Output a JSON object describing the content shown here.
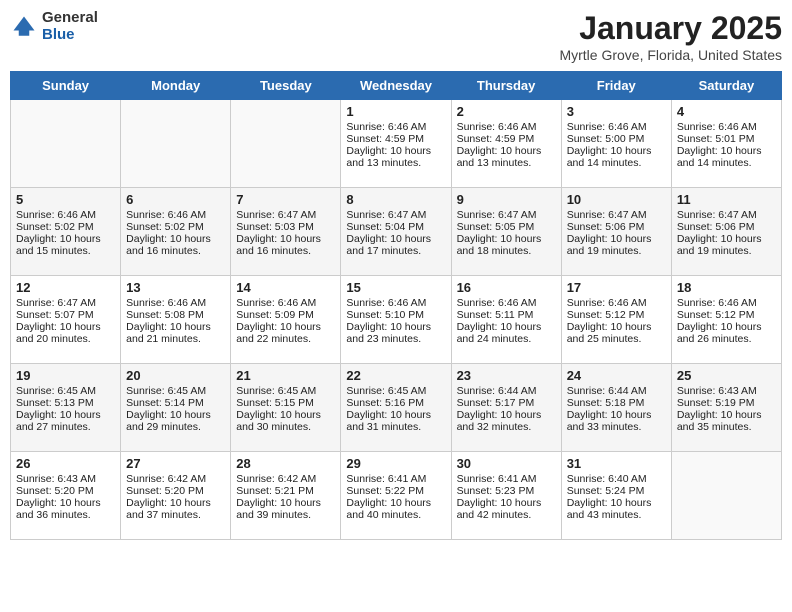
{
  "logo": {
    "general": "General",
    "blue": "Blue"
  },
  "title": "January 2025",
  "subtitle": "Myrtle Grove, Florida, United States",
  "weekdays": [
    "Sunday",
    "Monday",
    "Tuesday",
    "Wednesday",
    "Thursday",
    "Friday",
    "Saturday"
  ],
  "weeks": [
    [
      {
        "day": "",
        "content": ""
      },
      {
        "day": "",
        "content": ""
      },
      {
        "day": "",
        "content": ""
      },
      {
        "day": "1",
        "content": "Sunrise: 6:46 AM\nSunset: 4:59 PM\nDaylight: 10 hours\nand 13 minutes."
      },
      {
        "day": "2",
        "content": "Sunrise: 6:46 AM\nSunset: 4:59 PM\nDaylight: 10 hours\nand 13 minutes."
      },
      {
        "day": "3",
        "content": "Sunrise: 6:46 AM\nSunset: 5:00 PM\nDaylight: 10 hours\nand 14 minutes."
      },
      {
        "day": "4",
        "content": "Sunrise: 6:46 AM\nSunset: 5:01 PM\nDaylight: 10 hours\nand 14 minutes."
      }
    ],
    [
      {
        "day": "5",
        "content": "Sunrise: 6:46 AM\nSunset: 5:02 PM\nDaylight: 10 hours\nand 15 minutes."
      },
      {
        "day": "6",
        "content": "Sunrise: 6:46 AM\nSunset: 5:02 PM\nDaylight: 10 hours\nand 16 minutes."
      },
      {
        "day": "7",
        "content": "Sunrise: 6:47 AM\nSunset: 5:03 PM\nDaylight: 10 hours\nand 16 minutes."
      },
      {
        "day": "8",
        "content": "Sunrise: 6:47 AM\nSunset: 5:04 PM\nDaylight: 10 hours\nand 17 minutes."
      },
      {
        "day": "9",
        "content": "Sunrise: 6:47 AM\nSunset: 5:05 PM\nDaylight: 10 hours\nand 18 minutes."
      },
      {
        "day": "10",
        "content": "Sunrise: 6:47 AM\nSunset: 5:06 PM\nDaylight: 10 hours\nand 19 minutes."
      },
      {
        "day": "11",
        "content": "Sunrise: 6:47 AM\nSunset: 5:06 PM\nDaylight: 10 hours\nand 19 minutes."
      }
    ],
    [
      {
        "day": "12",
        "content": "Sunrise: 6:47 AM\nSunset: 5:07 PM\nDaylight: 10 hours\nand 20 minutes."
      },
      {
        "day": "13",
        "content": "Sunrise: 6:46 AM\nSunset: 5:08 PM\nDaylight: 10 hours\nand 21 minutes."
      },
      {
        "day": "14",
        "content": "Sunrise: 6:46 AM\nSunset: 5:09 PM\nDaylight: 10 hours\nand 22 minutes."
      },
      {
        "day": "15",
        "content": "Sunrise: 6:46 AM\nSunset: 5:10 PM\nDaylight: 10 hours\nand 23 minutes."
      },
      {
        "day": "16",
        "content": "Sunrise: 6:46 AM\nSunset: 5:11 PM\nDaylight: 10 hours\nand 24 minutes."
      },
      {
        "day": "17",
        "content": "Sunrise: 6:46 AM\nSunset: 5:12 PM\nDaylight: 10 hours\nand 25 minutes."
      },
      {
        "day": "18",
        "content": "Sunrise: 6:46 AM\nSunset: 5:12 PM\nDaylight: 10 hours\nand 26 minutes."
      }
    ],
    [
      {
        "day": "19",
        "content": "Sunrise: 6:45 AM\nSunset: 5:13 PM\nDaylight: 10 hours\nand 27 minutes."
      },
      {
        "day": "20",
        "content": "Sunrise: 6:45 AM\nSunset: 5:14 PM\nDaylight: 10 hours\nand 29 minutes."
      },
      {
        "day": "21",
        "content": "Sunrise: 6:45 AM\nSunset: 5:15 PM\nDaylight: 10 hours\nand 30 minutes."
      },
      {
        "day": "22",
        "content": "Sunrise: 6:45 AM\nSunset: 5:16 PM\nDaylight: 10 hours\nand 31 minutes."
      },
      {
        "day": "23",
        "content": "Sunrise: 6:44 AM\nSunset: 5:17 PM\nDaylight: 10 hours\nand 32 minutes."
      },
      {
        "day": "24",
        "content": "Sunrise: 6:44 AM\nSunset: 5:18 PM\nDaylight: 10 hours\nand 33 minutes."
      },
      {
        "day": "25",
        "content": "Sunrise: 6:43 AM\nSunset: 5:19 PM\nDaylight: 10 hours\nand 35 minutes."
      }
    ],
    [
      {
        "day": "26",
        "content": "Sunrise: 6:43 AM\nSunset: 5:20 PM\nDaylight: 10 hours\nand 36 minutes."
      },
      {
        "day": "27",
        "content": "Sunrise: 6:42 AM\nSunset: 5:20 PM\nDaylight: 10 hours\nand 37 minutes."
      },
      {
        "day": "28",
        "content": "Sunrise: 6:42 AM\nSunset: 5:21 PM\nDaylight: 10 hours\nand 39 minutes."
      },
      {
        "day": "29",
        "content": "Sunrise: 6:41 AM\nSunset: 5:22 PM\nDaylight: 10 hours\nand 40 minutes."
      },
      {
        "day": "30",
        "content": "Sunrise: 6:41 AM\nSunset: 5:23 PM\nDaylight: 10 hours\nand 42 minutes."
      },
      {
        "day": "31",
        "content": "Sunrise: 6:40 AM\nSunset: 5:24 PM\nDaylight: 10 hours\nand 43 minutes."
      },
      {
        "day": "",
        "content": ""
      }
    ]
  ]
}
